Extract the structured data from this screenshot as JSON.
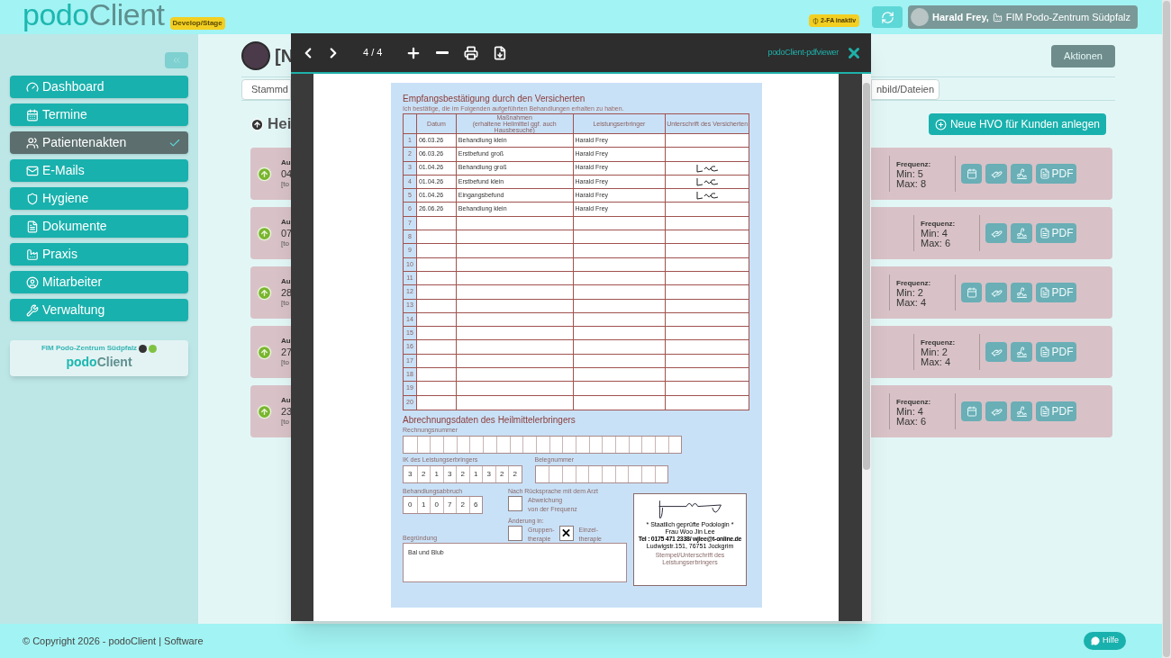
{
  "header": {
    "logo_primary": "podo",
    "logo_secondary": "Client",
    "env_badge": "Develop/Stage",
    "twofa_badge": "2-FA inaktiv",
    "user": "Harald Frey,",
    "practice": "FIM Podo-Zentrum Südpfalz"
  },
  "sidebar": {
    "items": [
      {
        "label": "Dashboard",
        "selected": false
      },
      {
        "label": "Termine",
        "selected": false
      },
      {
        "label": "Patientenakten",
        "selected": true
      },
      {
        "label": "E-Mails",
        "selected": false
      },
      {
        "label": "Hygiene",
        "selected": false
      },
      {
        "label": "Dokumente",
        "selected": false
      },
      {
        "label": "Praxis",
        "selected": false
      },
      {
        "label": "Mitarbeiter",
        "selected": false
      },
      {
        "label": "Verwaltung",
        "selected": false
      }
    ],
    "practice_card": {
      "name": "FIM Podo-Zentrum Südpfalz",
      "logo_primary": "podo",
      "logo_secondary": "Client"
    }
  },
  "patient": {
    "name": "[N",
    "actions_button": "Aktionen"
  },
  "tabs": [
    {
      "label": "Stammd"
    },
    {
      "label": "nbild/Dateien"
    }
  ],
  "section": {
    "title": "Hei",
    "new_button": "Neue HVO für Kunden anlegen"
  },
  "prescriptions": [
    {
      "label": "Au",
      "date": "04",
      "note": "[to",
      "frequency_label": "Frequenz:",
      "min": "Min: 5",
      "max": "Max: 8",
      "calendar_button": true,
      "pdf": "PDF"
    },
    {
      "label": "Au",
      "date": "07",
      "note": "[to",
      "frequency_label": "Frequenz:",
      "min": "Min: 4",
      "max": "Max: 6",
      "calendar_button": false,
      "pdf": "PDF"
    },
    {
      "label": "Au",
      "date": "28",
      "note": "[to",
      "frequency_label": "Frequenz:",
      "min": "Min: 2",
      "max": "Max: 4",
      "calendar_button": true,
      "pdf": "PDF"
    },
    {
      "label": "Au",
      "date": "27",
      "note": "[to",
      "frequency_label": "Frequenz:",
      "min": "Min: 2",
      "max": "Max: 4",
      "calendar_button": false,
      "pdf": "PDF"
    },
    {
      "label": "Au",
      "date": "23",
      "note": "[to",
      "frequency_label": "Frequenz:",
      "min": "Min: 4",
      "max": "Max: 6",
      "calendar_button": true,
      "pdf": "PDF"
    }
  ],
  "pdf_viewer": {
    "page": "4 / 4",
    "title": "podoClient-pdfviewer",
    "form": {
      "title": "Empfangsbestätigung durch den Versicherten",
      "intro": "Ich bestätige, die im Folgenden aufgeführten Behandlungen erhalten zu haben.",
      "columns": [
        {
          "label": "Datum"
        },
        {
          "label": "Maßnahmen",
          "sublabel": "(erhaltene Heilmittel ggf. auch Hausbesuche)"
        },
        {
          "label": "Leistungserbringer"
        },
        {
          "label": "Unterschrift des Versicherten"
        }
      ],
      "rows": [
        {
          "no": "1",
          "date": "06.03.26",
          "treatment": "Behandlung klein",
          "provider": "Harald Frey",
          "signed": false
        },
        {
          "no": "2",
          "date": "06.03.26",
          "treatment": "Erstbefund groß",
          "provider": "Harald Frey",
          "signed": false
        },
        {
          "no": "3",
          "date": "01.04.26",
          "treatment": "Behandlung groß",
          "provider": "Harald Frey",
          "signed": true
        },
        {
          "no": "4",
          "date": "01.04.26",
          "treatment": "Erstbefund klein",
          "provider": "Harald Frey",
          "signed": true
        },
        {
          "no": "5",
          "date": "01.04.26",
          "treatment": "Eingangsbefund",
          "provider": "Harald Frey",
          "signed": true
        },
        {
          "no": "6",
          "date": "26.06.26",
          "treatment": "Behandlung klein",
          "provider": "Harald Frey",
          "signed": false
        },
        {
          "no": "7",
          "signed": false
        },
        {
          "no": "8",
          "signed": false
        },
        {
          "no": "9",
          "signed": false
        },
        {
          "no": "10",
          "signed": false
        },
        {
          "no": "11",
          "signed": false
        },
        {
          "no": "12",
          "signed": false
        },
        {
          "no": "13",
          "signed": false
        },
        {
          "no": "14",
          "signed": false
        },
        {
          "no": "15",
          "signed": false
        },
        {
          "no": "16",
          "signed": false
        },
        {
          "no": "17",
          "signed": false
        },
        {
          "no": "18",
          "signed": false
        },
        {
          "no": "19",
          "signed": false
        },
        {
          "no": "20",
          "signed": false
        }
      ],
      "billing": {
        "title": "Abrechnungsdaten des Heilmittelerbringers",
        "invoice": {
          "label": "Rechnungsnummer"
        },
        "ik": {
          "label": "IK des Leistungserbringers",
          "digits": [
            "3",
            "2",
            "1",
            "3",
            "2",
            "1",
            "3",
            "2",
            "2"
          ]
        },
        "receipt": {
          "label": "Belegnummer"
        },
        "abort": {
          "label": "Behandlungsabbruch",
          "digits": [
            "0",
            "1",
            "0",
            "7",
            "2",
            "6"
          ]
        },
        "doctor": {
          "label": "Nach Rücksprache mit dem Arzt",
          "deviation": {
            "label": "Abweichung\nvon der Frequenz",
            "checked": false
          }
        },
        "change": {
          "label": "Änderung in:",
          "options": [
            {
              "label": "Gruppen-\ntherapie",
              "checked": false
            },
            {
              "label": "Einzel-\ntherapie",
              "checked": true
            }
          ]
        },
        "reason": {
          "label": "Begründung",
          "value": "Bal und Blub"
        },
        "stamp": {
          "lines": [
            "* Staatlich geprüfte Podologin *",
            "Frau Woo Jin Lee",
            "Tel : 0175 471 2338/ wjlee@t-online.de",
            "Ludwigstr.151, 76751 Jockgrim"
          ],
          "caption": "Stempel/Unterschrift des Leistungserbringers"
        }
      }
    }
  },
  "footer": {
    "copyright": "© Copyright 2026 - podoClient | Software",
    "help": "Hilfe"
  }
}
